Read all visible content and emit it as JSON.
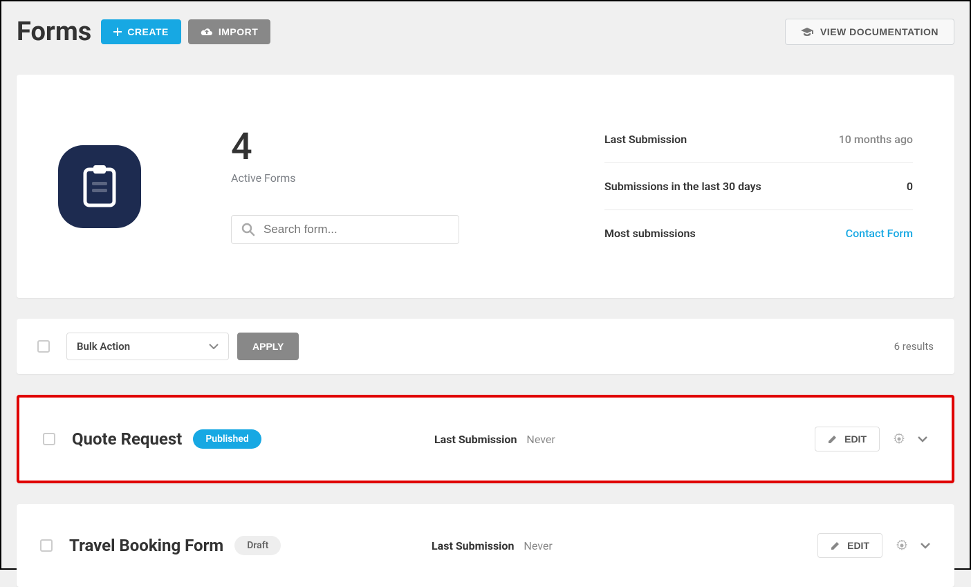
{
  "header": {
    "title": "Forms",
    "create_label": "CREATE",
    "import_label": "IMPORT",
    "docs_label": "VIEW DOCUMENTATION"
  },
  "stats": {
    "count": "4",
    "count_label": "Active Forms",
    "search_placeholder": "Search form...",
    "last_submission_label": "Last Submission",
    "last_submission_value": "10 months ago",
    "subs_30_label": "Submissions in the last 30 days",
    "subs_30_value": "0",
    "most_label": "Most submissions",
    "most_value": "Contact Form"
  },
  "bulk": {
    "select_label": "Bulk Action",
    "apply_label": "APPLY",
    "results_text": "6 results"
  },
  "forms": [
    {
      "name": "Quote Request",
      "status": "Published",
      "status_type": "published",
      "last_label": "Last Submission",
      "last_value": "Never",
      "edit_label": "EDIT",
      "highlighted": true
    },
    {
      "name": "Travel Booking Form",
      "status": "Draft",
      "status_type": "draft",
      "last_label": "Last Submission",
      "last_value": "Never",
      "edit_label": "EDIT",
      "highlighted": false
    }
  ]
}
